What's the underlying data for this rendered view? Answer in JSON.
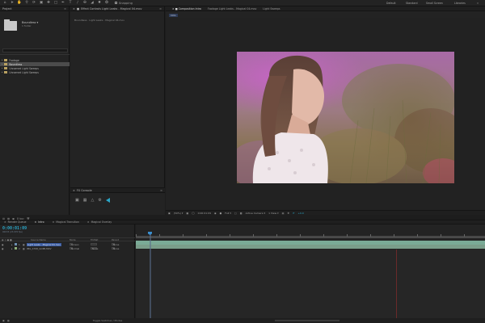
{
  "workspaces": {
    "default": "Default",
    "standard": "Standard",
    "small_screen": "Small Screen",
    "libraries": "Libraries"
  },
  "toolbar": {
    "snapping_label": "Snapping"
  },
  "project": {
    "tab_label": "Project",
    "item_name": "Boundless ▾",
    "item_info": "1 folder",
    "rows": [
      {
        "name": "Footage",
        "selected": false
      },
      {
        "name": "Boundless",
        "selected": true
      },
      {
        "name": "Unnamed Light Sweeps",
        "selected": false
      },
      {
        "name": "Unnamed Light Sweeps",
        "selected": false
      }
    ],
    "bpc": "8 bpc"
  },
  "effects": {
    "tab_label": "Effect Controls Light Leaks - Magical 04.mov",
    "subtitle": "Boundless · Light Leaks - Magical 04.mov"
  },
  "fx_console": {
    "tab_label": "FX Console"
  },
  "viewer": {
    "tabs": [
      {
        "label": "Composition Intro",
        "active": true
      },
      {
        "label": "Footage Light Leaks - Magical 04.mov",
        "active": false
      },
      {
        "label": "Light Sweeps",
        "active": false
      }
    ],
    "comp_chip": "Intro",
    "footer": {
      "zoom": "(50%)",
      "timecode": "0:00:01:09",
      "resolution": "Full",
      "camera": "Active Camera",
      "views": "1 View",
      "offset": "+0.0"
    }
  },
  "timeline": {
    "tabs": [
      {
        "label": "Render Queue",
        "active": false
      },
      {
        "label": "Intro",
        "active": true
      },
      {
        "label": "Magical Transition",
        "active": false
      },
      {
        "label": "Magical Overlay",
        "active": false
      }
    ],
    "timecode": "0:00:01:09",
    "frames": "00033 (23.976 fps)",
    "col_headers": {
      "source_name": "Source Name",
      "mode": "Mode",
      "trkmat": "TrkMat",
      "parent": "Parent"
    },
    "layers": [
      {
        "num": "1",
        "name": "Light Leaks - Magical 04.mov",
        "mode": "Screen",
        "trkmat": "",
        "parent": "None",
        "label_color": "#6d8fb0",
        "selected": true
      },
      {
        "num": "2",
        "name": "IMG_4708_GOPR.MOV",
        "mode": "Normal",
        "trkmat": "None",
        "parent": "None",
        "label_color": "#8fb07a",
        "selected": false
      }
    ],
    "playhead_fraction": 0.04,
    "end_fraction": 0.745
  },
  "bottom": {
    "toggle_label": "Toggle Switches / Modes"
  },
  "colors": {
    "accent": "#2aa7c9",
    "selection": "#3a5ba0",
    "track_bar": "#7aaa96"
  }
}
